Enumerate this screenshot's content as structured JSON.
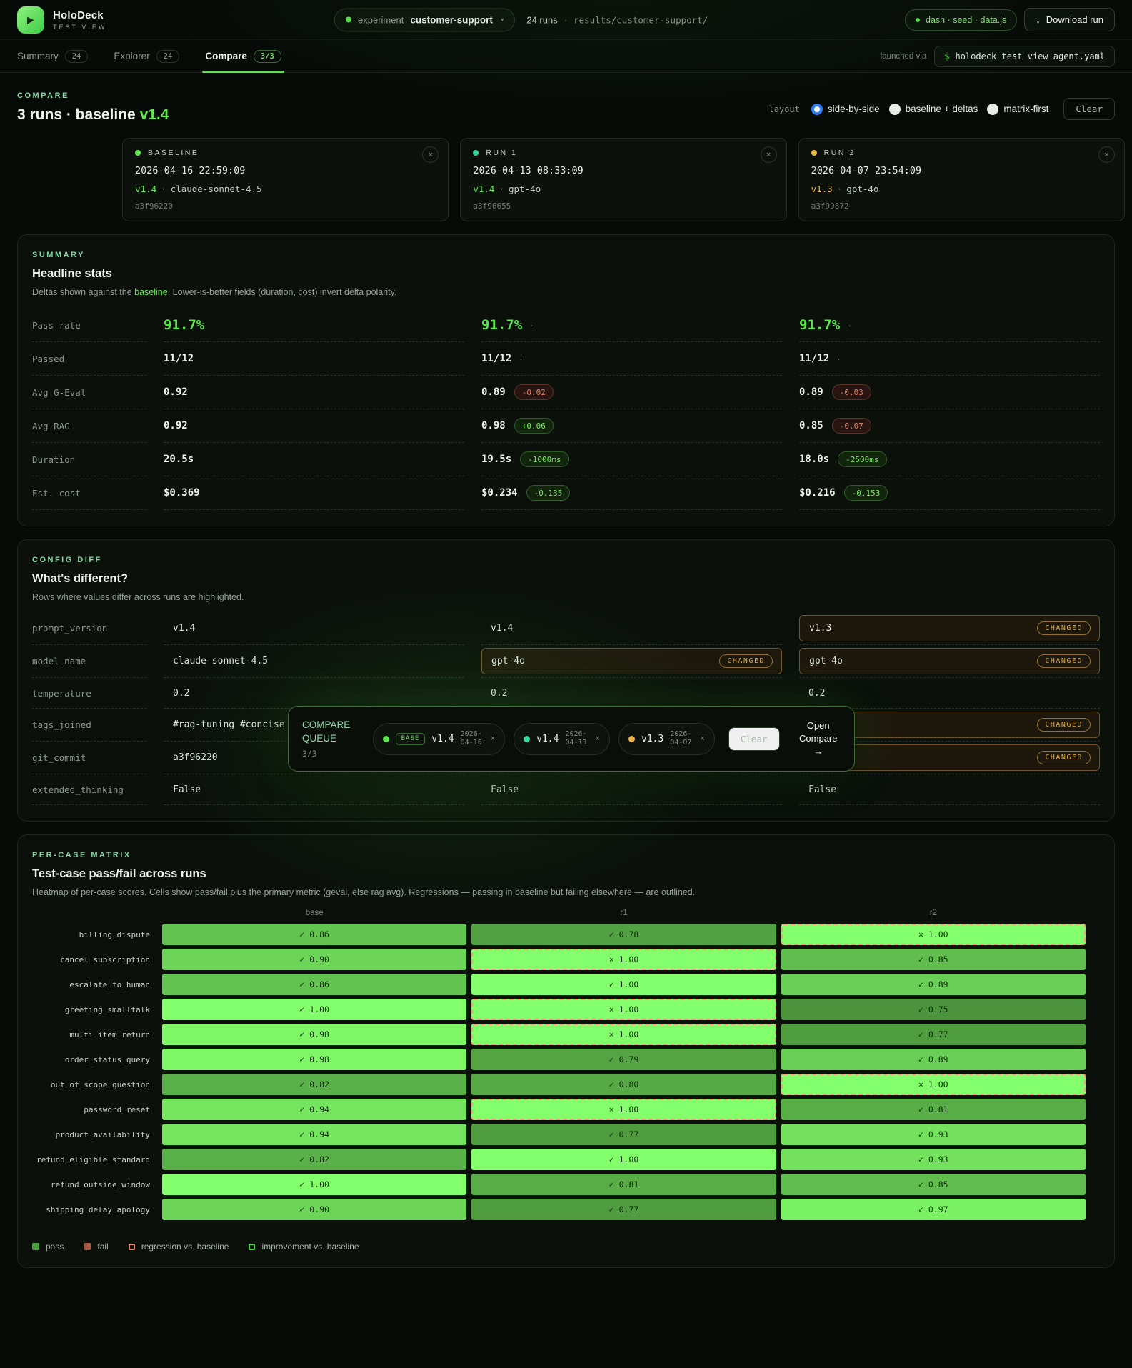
{
  "colors": {
    "accent_green": "#5ae64a",
    "kicker_teal": "#86d7a6",
    "amber": "#d9a93e",
    "delta_bad": "#df8365",
    "radio_selected_blue": "#2e7ef5",
    "regression_outline": "#f0a181",
    "heat_low": "#448636",
    "heat_high": "#82ff6a"
  },
  "header": {
    "app_name": "HoloDeck",
    "app_subtitle": "TEST VIEW",
    "logo_icon": "play-icon",
    "experiment_label": "experiment",
    "experiment_name": "customer-support",
    "runs_count": "24 runs",
    "runs_sep": "·",
    "runs_path": "results/customer-support/",
    "artifacts_pill": "dash · seed · data.js",
    "download_icon": "↓",
    "download_label": "Download run"
  },
  "tabs": [
    {
      "label": "Summary",
      "badge": "24",
      "active": false
    },
    {
      "label": "Explorer",
      "badge": "24",
      "active": false
    },
    {
      "label": "Compare",
      "badge": "3/3",
      "active": true
    }
  ],
  "launched": {
    "label": "launched via",
    "prompt": "$",
    "command": "holodeck test view agent.yaml"
  },
  "compare_header": {
    "kicker": "COMPARE",
    "title_prefix": "3 runs · baseline ",
    "title_version": "v1.4",
    "layout_label": "layout",
    "layout_options": [
      {
        "label": "side-by-side",
        "selected": true
      },
      {
        "label": "baseline + deltas",
        "selected": false
      },
      {
        "label": "matrix-first",
        "selected": false
      }
    ],
    "clear_label": "Clear"
  },
  "run_cards": [
    {
      "role": "BASELINE",
      "dot_color": "#5ee84f",
      "datetime": "2026-04-16 22:59:09",
      "version": "v1.4",
      "version_color": "#62e84f",
      "model": "claude-sonnet-4.5",
      "hash": "a3f96220",
      "close_icon": "×"
    },
    {
      "role": "RUN 1",
      "dot_color": "#34d9a0",
      "datetime": "2026-04-13 08:33:09",
      "version": "v1.4",
      "version_color": "#62e84f",
      "model": "gpt-4o",
      "hash": "a3f96655",
      "close_icon": "×"
    },
    {
      "role": "RUN 2",
      "dot_color": "#e9b44a",
      "datetime": "2026-04-07 23:54:09",
      "version": "v1.3",
      "version_color": "#e9b44a",
      "model": "gpt-4o",
      "hash": "a3f99872",
      "close_icon": "×"
    }
  ],
  "summary": {
    "kicker": "SUMMARY",
    "title": "Headline stats",
    "desc_pre": "Deltas shown against the ",
    "desc_link": "baseline",
    "desc_post": ". Lower-is-better fields (duration, cost) invert delta polarity.",
    "rows": [
      {
        "label": "Pass rate",
        "big": true,
        "cells": [
          {
            "value": "91.7%"
          },
          {
            "value": "91.7%",
            "suffix": "·"
          },
          {
            "value": "91.7%",
            "suffix": "·"
          }
        ]
      },
      {
        "label": "Passed",
        "big": false,
        "cells": [
          {
            "value": "11/12"
          },
          {
            "value": "11/12",
            "suffix": "·"
          },
          {
            "value": "11/12",
            "suffix": "·"
          }
        ]
      },
      {
        "label": "Avg G-Eval",
        "big": false,
        "cells": [
          {
            "value": "0.92"
          },
          {
            "value": "0.89",
            "delta": "-0.02",
            "delta_kind": "bad"
          },
          {
            "value": "0.89",
            "delta": "-0.03",
            "delta_kind": "bad"
          }
        ]
      },
      {
        "label": "Avg RAG",
        "big": false,
        "cells": [
          {
            "value": "0.92"
          },
          {
            "value": "0.98",
            "delta": "+0.06",
            "delta_kind": "good"
          },
          {
            "value": "0.85",
            "delta": "-0.07",
            "delta_kind": "bad"
          }
        ]
      },
      {
        "label": "Duration",
        "big": false,
        "cells": [
          {
            "value": "20.5s"
          },
          {
            "value": "19.5s",
            "delta": "-1000ms",
            "delta_kind": "good"
          },
          {
            "value": "18.0s",
            "delta": "-2500ms",
            "delta_kind": "good"
          }
        ]
      },
      {
        "label": "Est. cost",
        "big": false,
        "cells": [
          {
            "value": "$0.369"
          },
          {
            "value": "$0.234",
            "delta": "-0.135",
            "delta_kind": "good"
          },
          {
            "value": "$0.216",
            "delta": "-0.153",
            "delta_kind": "good"
          }
        ]
      }
    ]
  },
  "config_diff": {
    "kicker": "CONFIG DIFF",
    "title": "What's different?",
    "desc": "Rows where values differ across runs are highlighted.",
    "changed_badge": "CHANGED",
    "rows": [
      {
        "key": "prompt_version",
        "cells": [
          {
            "value": "v1.4"
          },
          {
            "value": "v1.4"
          },
          {
            "value": "v1.3",
            "changed": true
          }
        ]
      },
      {
        "key": "model_name",
        "cells": [
          {
            "value": "claude-sonnet-4.5"
          },
          {
            "value": "gpt-4o",
            "changed": true
          },
          {
            "value": "gpt-4o",
            "changed": true
          }
        ]
      },
      {
        "key": "temperature",
        "cells": [
          {
            "value": "0.2"
          },
          {
            "value": "0.2"
          },
          {
            "value": "0.2"
          }
        ]
      },
      {
        "key": "tags_joined",
        "cells": [
          {
            "value": "#rag-tuning #concise"
          },
          {
            "value": ""
          },
          {
            "value": "",
            "changed": true
          }
        ]
      },
      {
        "key": "git_commit",
        "cells": [
          {
            "value": "a3f96220"
          },
          {
            "value": ""
          },
          {
            "value": "",
            "changed": true
          }
        ]
      },
      {
        "key": "extended_thinking",
        "cells": [
          {
            "value": "False"
          },
          {
            "value": "False"
          },
          {
            "value": "False"
          }
        ]
      }
    ]
  },
  "compare_queue": {
    "title": "COMPARE QUEUE",
    "count": "3/3",
    "items": [
      {
        "base_badge": "BASE",
        "dot_color": "#5ee84f",
        "version": "v1.4",
        "date_line1": "2026-",
        "date_line2": "04-16",
        "remove_icon": "×"
      },
      {
        "base_badge": null,
        "dot_color": "#34d9a0",
        "version": "v1.4",
        "date_line1": "2026-",
        "date_line2": "04-13",
        "remove_icon": "×"
      },
      {
        "base_badge": null,
        "dot_color": "#e9b44a",
        "version": "v1.3",
        "date_line1": "2026-",
        "date_line2": "04-07",
        "remove_icon": "×"
      }
    ],
    "clear_label": "Clear",
    "open_line1": "Open",
    "open_line2": "Compare →"
  },
  "matrix": {
    "kicker": "PER-CASE MATRIX",
    "title": "Test-case pass/fail across runs",
    "desc": "Heatmap of per-case scores. Cells show pass/fail plus the primary metric (geval, else rag avg). Regressions — passing in baseline but failing elsewhere — are outlined.",
    "columns": [
      "base",
      "r1",
      "r2"
    ],
    "pass_glyph": "✓",
    "fail_glyph": "×",
    "rows": [
      {
        "case": "billing_dispute",
        "cells": [
          {
            "pass": true,
            "score": 0.86
          },
          {
            "pass": true,
            "score": 0.78
          },
          {
            "pass": false,
            "score": 1.0,
            "regression": true
          }
        ]
      },
      {
        "case": "cancel_subscription",
        "cells": [
          {
            "pass": true,
            "score": 0.9
          },
          {
            "pass": false,
            "score": 1.0,
            "regression": true
          },
          {
            "pass": true,
            "score": 0.85
          }
        ]
      },
      {
        "case": "escalate_to_human",
        "cells": [
          {
            "pass": true,
            "score": 0.86
          },
          {
            "pass": true,
            "score": 1.0
          },
          {
            "pass": true,
            "score": 0.89
          }
        ]
      },
      {
        "case": "greeting_smalltalk",
        "cells": [
          {
            "pass": true,
            "score": 1.0
          },
          {
            "pass": false,
            "score": 1.0,
            "regression": true
          },
          {
            "pass": true,
            "score": 0.75
          }
        ]
      },
      {
        "case": "multi_item_return",
        "cells": [
          {
            "pass": true,
            "score": 0.98
          },
          {
            "pass": false,
            "score": 1.0,
            "regression": true
          },
          {
            "pass": true,
            "score": 0.77
          }
        ]
      },
      {
        "case": "order_status_query",
        "cells": [
          {
            "pass": true,
            "score": 0.98
          },
          {
            "pass": true,
            "score": 0.79
          },
          {
            "pass": true,
            "score": 0.89
          }
        ]
      },
      {
        "case": "out_of_scope_question",
        "cells": [
          {
            "pass": true,
            "score": 0.82
          },
          {
            "pass": true,
            "score": 0.8
          },
          {
            "pass": false,
            "score": 1.0,
            "regression": true
          }
        ]
      },
      {
        "case": "password_reset",
        "cells": [
          {
            "pass": true,
            "score": 0.94
          },
          {
            "pass": false,
            "score": 1.0,
            "regression": true
          },
          {
            "pass": true,
            "score": 0.81
          }
        ]
      },
      {
        "case": "product_availability",
        "cells": [
          {
            "pass": true,
            "score": 0.94
          },
          {
            "pass": true,
            "score": 0.77
          },
          {
            "pass": true,
            "score": 0.93
          }
        ]
      },
      {
        "case": "refund_eligible_standard",
        "cells": [
          {
            "pass": true,
            "score": 0.82
          },
          {
            "pass": true,
            "score": 1.0
          },
          {
            "pass": true,
            "score": 0.93
          }
        ]
      },
      {
        "case": "refund_outside_window",
        "cells": [
          {
            "pass": true,
            "score": 1.0
          },
          {
            "pass": true,
            "score": 0.81
          },
          {
            "pass": true,
            "score": 0.85
          }
        ]
      },
      {
        "case": "shipping_delay_apology",
        "cells": [
          {
            "pass": true,
            "score": 0.9
          },
          {
            "pass": true,
            "score": 0.77
          },
          {
            "pass": true,
            "score": 0.97
          }
        ]
      }
    ],
    "legend": {
      "pass": "pass",
      "fail": "fail",
      "regression": "regression vs. baseline",
      "improvement": "improvement vs. baseline"
    }
  }
}
